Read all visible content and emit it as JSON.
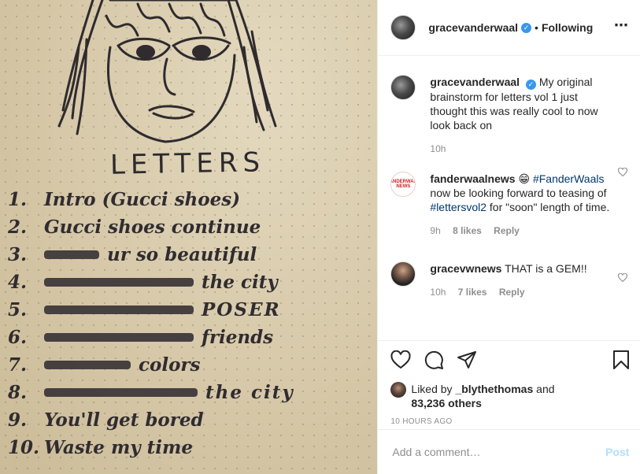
{
  "photo": {
    "title": "LETTERS",
    "tracks": [
      {
        "num": "1.",
        "text": "Intro (Gucci shoes)",
        "strike": 0
      },
      {
        "num": "2.",
        "text": "Gucci shoes continue",
        "strike": 0
      },
      {
        "num": "3.",
        "text": "ur so beautiful",
        "strike": 1
      },
      {
        "num": "4.",
        "text": "the city",
        "strike": 2
      },
      {
        "num": "5.",
        "text": "POSER",
        "strike": 3
      },
      {
        "num": "6.",
        "text": "friends",
        "strike": 3
      },
      {
        "num": "7.",
        "text": "colors",
        "strike": 2
      },
      {
        "num": "8.",
        "text": "the city",
        "strike": 3
      },
      {
        "num": "9.",
        "text": "You'll get bored",
        "strike": 0
      },
      {
        "num": "10.",
        "text": "Waste my time",
        "strike": 0
      }
    ]
  },
  "header": {
    "username": "gracevanderwaal",
    "separator": "•",
    "follow_status": "Following",
    "more_icon": "⋯"
  },
  "comments": [
    {
      "author": "gracevanderwaal",
      "verified": true,
      "text": "My original brainstorm for letters vol 1 just thought this was really cool to now look back on",
      "time": "10h"
    },
    {
      "author": "fanderwaalnews",
      "emoji": "😁",
      "hashtag1": "#FanderWaals",
      "text1": "now be looking forward to teasing of",
      "hashtag2": "#lettersvol2",
      "text2": "for \"soon\" length of time.",
      "time": "9h",
      "likes": "8 likes",
      "reply": "Reply",
      "avatar_text": "FANDERWAAL NEWS"
    },
    {
      "author": "gracevwnews",
      "text": "THAT is a GEM!!",
      "time": "10h",
      "likes": "7 likes",
      "reply": "Reply"
    }
  ],
  "actions": {
    "liked_prefix": "Liked by",
    "liked_user": "_blythethomas",
    "liked_and": "and",
    "liked_others": "83,236 others",
    "time_ago": "10 HOURS AGO"
  },
  "add_comment": {
    "placeholder": "Add a comment…",
    "post_label": "Post"
  },
  "colors": {
    "accent": "#3897f0",
    "hashtag": "#00376b",
    "muted": "#8e8e8e",
    "post_disabled": "#b2dffc"
  }
}
